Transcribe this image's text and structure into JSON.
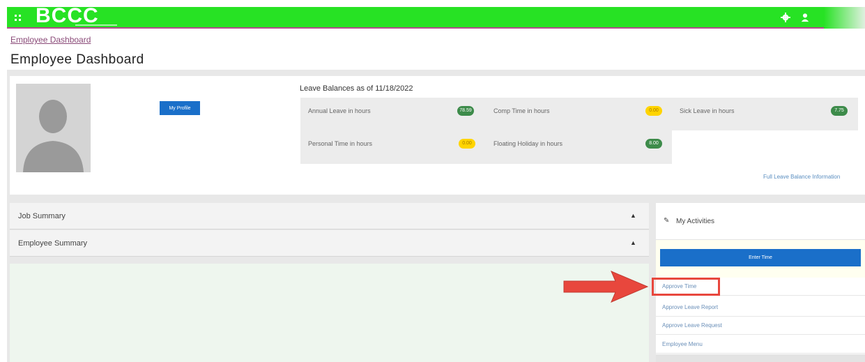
{
  "header": {
    "brand": "BCCC",
    "colors": {
      "bar": "#27e224",
      "accent_line": "#b34b8d"
    }
  },
  "breadcrumb": "Employee Dashboard",
  "page_title": "Employee Dashboard",
  "profile": {
    "button_label": "My Profile"
  },
  "leave": {
    "heading": "Leave Balances as of 11/18/2022",
    "items": [
      {
        "label": "Annual Leave in hours",
        "value": "78.59",
        "status": "green"
      },
      {
        "label": "Comp Time in hours",
        "value": "0.00",
        "status": "yellow"
      },
      {
        "label": "Sick Leave in hours",
        "value": "7.75",
        "status": "green"
      },
      {
        "label": "Personal Time in hours",
        "value": "0.00",
        "status": "yellow"
      },
      {
        "label": "Floating Holiday in hours",
        "value": "8.00",
        "status": "green"
      }
    ],
    "full_link": "Full Leave Balance Information"
  },
  "summaries": [
    {
      "label": "Job Summary"
    },
    {
      "label": "Employee Summary"
    }
  ],
  "activities": {
    "title": "My Activities",
    "enter_time": "Enter Time",
    "links": [
      {
        "label": "Approve Time"
      },
      {
        "label": "Approve Leave Report"
      },
      {
        "label": "Approve Leave Request"
      },
      {
        "label": "Employee Menu"
      }
    ]
  },
  "annotation_colors": {
    "arrow": "#e8473d"
  }
}
